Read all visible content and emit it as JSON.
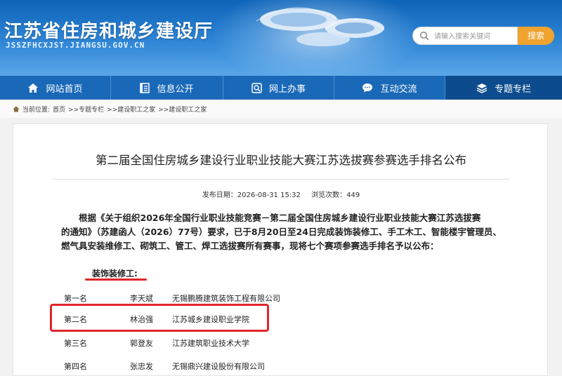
{
  "header": {
    "title": "江苏省住房和城乡建设厅",
    "url": "JSSZFHCXJST.JIANGSU.GOV.CN",
    "search_placeholder": "请输入搜索关键词",
    "search_button": "搜索"
  },
  "nav": [
    {
      "label": "网站首页",
      "icon": "home-icon"
    },
    {
      "label": "信息公开",
      "icon": "document-icon"
    },
    {
      "label": "网上办事",
      "icon": "service-icon"
    },
    {
      "label": "互动交流",
      "icon": "chat-icon"
    },
    {
      "label": "专题专栏",
      "icon": "layers-icon"
    }
  ],
  "breadcrumb": {
    "prefix": "当前位置:",
    "items": [
      "首页",
      ">>专题专栏",
      ">>建设职工之家",
      ">>建设职工之家"
    ]
  },
  "article": {
    "title": "第二届全国住房城乡建设行业职业技能大赛江苏选拔赛参赛选手排名公布",
    "publish_label": "发布日期：",
    "publish_date": "2026-08-31 15:32",
    "views_label": "浏览次数：",
    "views": "449",
    "paragraph_lines": [
      "根据《关于组织2026年全国行业职业技能竞赛－第二届全国住房城乡建设行业职业技能大赛江苏选拔赛",
      "的通知》（苏建函人（2026）77号）要求，已于8月20日至24日完成装饰装修工、手工木工、智能楼宇管理员、",
      "燃气具安装维修工、砌筑工、管工、焊工选拔赛所有赛事，现将七个赛项参赛选手排名予以公布："
    ],
    "section": "装饰装修工:",
    "rankings": [
      {
        "rank": "第一名",
        "name": "李天斌",
        "org": "无锡鹏腾建筑装饰工程有限公司"
      },
      {
        "rank": "第二名",
        "name": "林治强",
        "org": "江苏城乡建设职业学院"
      },
      {
        "rank": "第三名",
        "name": "郭登友",
        "org": "江苏建筑职业技术大学"
      },
      {
        "rank": "第四名",
        "name": "张忠发",
        "org": "无锡鼎兴建设股份有限公司"
      }
    ]
  },
  "colors": {
    "header_blue": "#1a69b8",
    "nav_active": "#0c4c8e",
    "search_button": "#f0a32e",
    "highlight_red": "#e0262d"
  }
}
